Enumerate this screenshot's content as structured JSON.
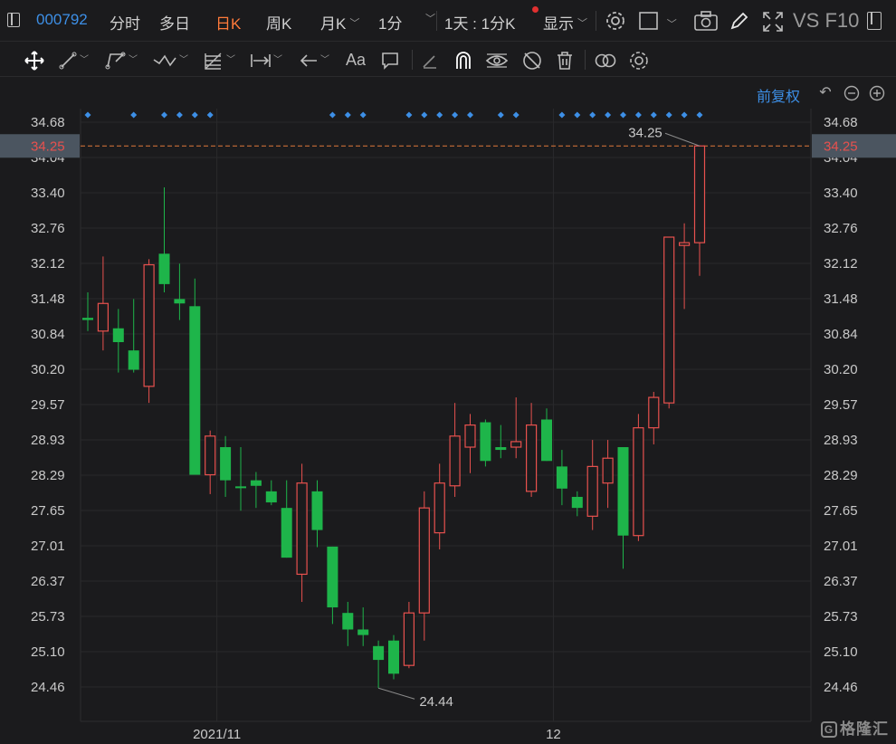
{
  "header": {
    "stock_code": "000792",
    "tabs": [
      "分时",
      "多日",
      "日K",
      "周K",
      "月K"
    ],
    "active_tab": "日K",
    "interval": "1分",
    "period": "1天 : 1分K",
    "display": "显示",
    "right_label": "VS F10"
  },
  "subheader": {
    "adjust_label": "前复权"
  },
  "watermark": "格隆汇",
  "colors": {
    "up": "#e8514e",
    "down": "#1eb54a",
    "accent_blue": "#3d8fe6",
    "price_line": "#e0783a",
    "background": "#1b1b1d"
  },
  "icons": [
    "move-icon",
    "line-icon",
    "polyline-icon",
    "wave-icon",
    "fibonacci-icon",
    "range-icon",
    "arrow-left-icon",
    "text-icon",
    "note-icon",
    "pencil-icon",
    "magnet-icon",
    "eye-icon",
    "hide-icon",
    "trash-icon",
    "link-icon",
    "settings-icon",
    "camera-icon",
    "fullscreen-icon",
    "restore-icon",
    "zoom-out-icon",
    "zoom-in-icon"
  ],
  "chart_data": {
    "type": "candlestick",
    "y_ticks": [
      "34.68",
      "34.04",
      "33.40",
      "32.76",
      "32.12",
      "31.48",
      "30.84",
      "30.20",
      "29.57",
      "28.93",
      "28.29",
      "27.65",
      "27.01",
      "26.37",
      "25.73",
      "25.10",
      "24.46"
    ],
    "ylim": [
      23.8,
      34.9
    ],
    "x_labels": [
      {
        "index": 9,
        "text": "2021/11"
      },
      {
        "index": 31,
        "text": "12"
      }
    ],
    "current_price": "34.25",
    "high_annotation": "34.25",
    "low_annotation": "24.44",
    "event_marker_indices": [
      0,
      3,
      5,
      6,
      7,
      8,
      16,
      17,
      18,
      21,
      22,
      23,
      24,
      25,
      27,
      28,
      31,
      32,
      33,
      34,
      35,
      36,
      37,
      38,
      39,
      40
    ],
    "candles": [
      {
        "o": 31.14,
        "h": 31.6,
        "l": 30.9,
        "c": 31.1
      },
      {
        "o": 30.9,
        "h": 32.25,
        "l": 30.55,
        "c": 31.4
      },
      {
        "o": 30.95,
        "h": 31.3,
        "l": 30.15,
        "c": 30.7
      },
      {
        "o": 30.55,
        "h": 31.48,
        "l": 30.15,
        "c": 30.2
      },
      {
        "o": 29.9,
        "h": 32.2,
        "l": 29.6,
        "c": 32.1
      },
      {
        "o": 32.3,
        "h": 33.5,
        "l": 31.6,
        "c": 31.75
      },
      {
        "o": 31.48,
        "h": 32.12,
        "l": 31.1,
        "c": 31.4
      },
      {
        "o": 31.35,
        "h": 31.85,
        "l": 28.3,
        "c": 28.3
      },
      {
        "o": 28.3,
        "h": 29.1,
        "l": 27.95,
        "c": 29.0
      },
      {
        "o": 28.8,
        "h": 29.0,
        "l": 27.9,
        "c": 28.2
      },
      {
        "o": 28.09,
        "h": 28.8,
        "l": 27.65,
        "c": 28.07
      },
      {
        "o": 28.2,
        "h": 28.35,
        "l": 27.7,
        "c": 28.1
      },
      {
        "o": 28.0,
        "h": 28.2,
        "l": 27.75,
        "c": 27.8
      },
      {
        "o": 27.7,
        "h": 28.2,
        "l": 26.8,
        "c": 26.8
      },
      {
        "o": 26.5,
        "h": 28.5,
        "l": 26.0,
        "c": 28.15
      },
      {
        "o": 28.0,
        "h": 28.2,
        "l": 26.99,
        "c": 27.3
      },
      {
        "o": 27.0,
        "h": 27.0,
        "l": 25.6,
        "c": 25.9
      },
      {
        "o": 25.8,
        "h": 26.0,
        "l": 25.2,
        "c": 25.5
      },
      {
        "o": 25.5,
        "h": 25.9,
        "l": 25.2,
        "c": 25.4
      },
      {
        "o": 25.2,
        "h": 25.3,
        "l": 24.44,
        "c": 24.95
      },
      {
        "o": 25.3,
        "h": 25.4,
        "l": 24.6,
        "c": 24.7
      },
      {
        "o": 24.85,
        "h": 26.0,
        "l": 24.8,
        "c": 25.8
      },
      {
        "o": 25.8,
        "h": 28.0,
        "l": 25.3,
        "c": 27.7
      },
      {
        "o": 27.25,
        "h": 28.5,
        "l": 26.95,
        "c": 28.15
      },
      {
        "o": 28.1,
        "h": 29.6,
        "l": 27.9,
        "c": 29.0
      },
      {
        "o": 28.8,
        "h": 29.4,
        "l": 28.33,
        "c": 29.2
      },
      {
        "o": 29.25,
        "h": 29.3,
        "l": 28.45,
        "c": 28.55
      },
      {
        "o": 28.8,
        "h": 29.2,
        "l": 28.6,
        "c": 28.75
      },
      {
        "o": 28.8,
        "h": 29.7,
        "l": 28.6,
        "c": 28.9
      },
      {
        "o": 28.0,
        "h": 29.6,
        "l": 27.9,
        "c": 29.2
      },
      {
        "o": 29.3,
        "h": 29.5,
        "l": 28.55,
        "c": 28.55
      },
      {
        "o": 28.45,
        "h": 28.75,
        "l": 27.75,
        "c": 28.05
      },
      {
        "o": 27.9,
        "h": 28.0,
        "l": 27.55,
        "c": 27.7
      },
      {
        "o": 27.55,
        "h": 28.93,
        "l": 27.3,
        "c": 28.45
      },
      {
        "o": 28.15,
        "h": 28.93,
        "l": 27.7,
        "c": 28.6
      },
      {
        "o": 28.8,
        "h": 28.8,
        "l": 26.6,
        "c": 27.2
      },
      {
        "o": 27.2,
        "h": 29.4,
        "l": 27.1,
        "c": 29.15
      },
      {
        "o": 29.15,
        "h": 29.8,
        "l": 28.85,
        "c": 29.7
      },
      {
        "o": 29.6,
        "h": 32.6,
        "l": 29.5,
        "c": 32.6
      },
      {
        "o": 32.45,
        "h": 32.85,
        "l": 31.3,
        "c": 32.5
      },
      {
        "o": 32.5,
        "h": 34.25,
        "l": 31.9,
        "c": 34.25
      }
    ]
  }
}
